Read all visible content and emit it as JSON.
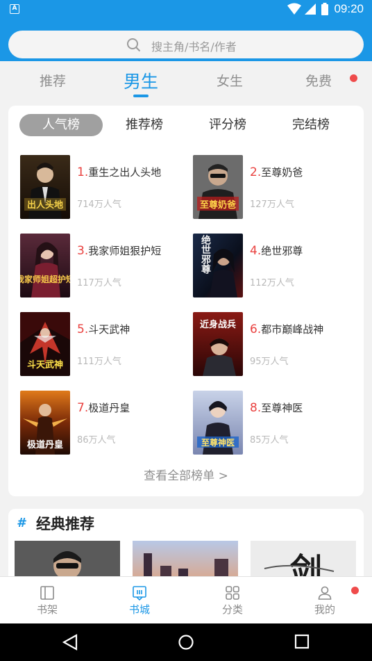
{
  "status": {
    "time": "09:20",
    "app_badge": "A"
  },
  "search": {
    "placeholder": "搜主角/书名/作者"
  },
  "category_tabs": [
    {
      "label": "推荐"
    },
    {
      "label": "男生",
      "active": true
    },
    {
      "label": "女生"
    },
    {
      "label": "免费",
      "badge": true
    }
  ],
  "rank_tabs": [
    {
      "label": "人气榜",
      "active": true
    },
    {
      "label": "推荐榜"
    },
    {
      "label": "评分榜"
    },
    {
      "label": "完结榜"
    }
  ],
  "books": [
    {
      "rank": "1.",
      "title": "重生之出人头地",
      "popularity": "714万人气",
      "cover_text": "出人头地"
    },
    {
      "rank": "2.",
      "title": "至尊奶爸",
      "popularity": "127万人气",
      "cover_text": "至尊奶爸"
    },
    {
      "rank": "3.",
      "title": "我家师姐狠护短",
      "popularity": "117万人气",
      "cover_text": "我家师姐超护短"
    },
    {
      "rank": "4.",
      "title": "绝世邪尊",
      "popularity": "112万人气",
      "cover_text": "绝世邪尊"
    },
    {
      "rank": "5.",
      "title": "斗天武神",
      "popularity": "111万人气",
      "cover_text": "斗天武神"
    },
    {
      "rank": "6.",
      "title": "都市巅峰战神",
      "popularity": "95万人气",
      "cover_text": "近身战兵"
    },
    {
      "rank": "7.",
      "title": "极道丹皇",
      "popularity": "86万人气",
      "cover_text": "极道丹皇"
    },
    {
      "rank": "8.",
      "title": "至尊神医",
      "popularity": "85万人气",
      "cover_text": "至尊神医"
    }
  ],
  "see_all": "查看全部榜单 >",
  "classic": {
    "hash": "#",
    "title": "经典推荐",
    "cover_text": "剑"
  },
  "bottom_nav": [
    {
      "label": "书架",
      "icon": "bookshelf-icon"
    },
    {
      "label": "书城",
      "icon": "bookstore-icon",
      "active": true
    },
    {
      "label": "分类",
      "icon": "category-grid-icon"
    },
    {
      "label": "我的",
      "icon": "profile-icon",
      "badge": true
    }
  ],
  "colors": {
    "primary": "#1b97e6",
    "rank_number": "#e9413f",
    "badge": "#ef4b4b"
  }
}
